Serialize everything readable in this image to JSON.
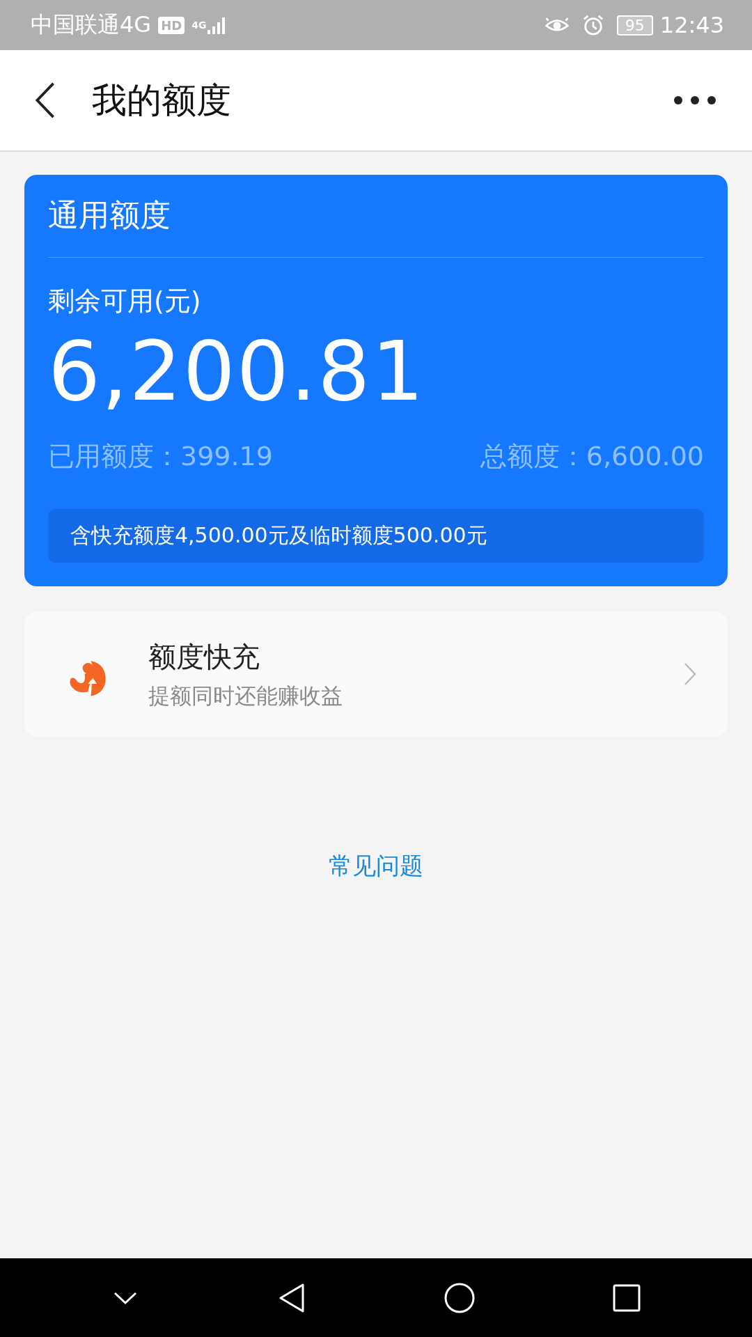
{
  "status_bar": {
    "carrier": "中国联通4G",
    "hd_badge": "HD",
    "network": "4G",
    "battery": "95",
    "time": "12:43"
  },
  "header": {
    "title": "我的额度"
  },
  "credit_card": {
    "title": "通用额度",
    "available_label": "剩余可用(元)",
    "available_amount": "6,200.81",
    "used_label": "已用额度：",
    "used_amount": "399.19",
    "total_label": "总额度：",
    "total_amount": "6,600.00",
    "note": "含快充额度4,500.00元及临时额度500.00元"
  },
  "quick_recharge": {
    "title": "额度快充",
    "subtitle": "提额同时还能赚收益"
  },
  "faq_link": "常见问题"
}
